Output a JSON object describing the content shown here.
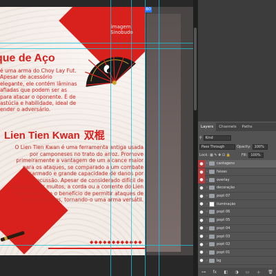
{
  "document": {
    "title1": "que de Aço",
    "para1": "é uma arma do Choy Lay Fut. Apesar de acessório elegante, ele contém lâminas afiadas que podem ser as para atacar o oponente. É de astúcia e habilidade, ideal de ender o adversário.",
    "title2": "Lien Tien Kwan",
    "title2_cn": "双棍",
    "para2": "O Lien Tien Kwan é uma ferramenta antiga usada por camponeses no trato do arroz. Promove primeiramente a vantagem de um alcance maior para os ataques, se comparado a um combate desarmado e grande capacidade de danos por concussão. Apesar de considerado difícil de controlar por muitos, a corda ou a corrente do Lien Tien Kwan tem o benefício de permitir ataques de vários ângulos, tornando-o uma arma versátil.",
    "image_caption": "imagem:\nSinobudo",
    "accent_color": "#d8201c"
  },
  "panel": {
    "tabs": [
      "Layers",
      "Channels",
      "Paths"
    ],
    "kind_label": "Kind",
    "blend_mode": "Pass Through",
    "opacity_label": "Opacity:",
    "opacity_value": "100%",
    "lock_label": "Lock:",
    "fill_label": "Fill:",
    "fill_value": "100%"
  },
  "layers": [
    {
      "name": "cantagens",
      "eye": true,
      "red": true,
      "type": "folder",
      "selected": true
    },
    {
      "name": "faixas",
      "eye": true,
      "red": true,
      "type": "folder"
    },
    {
      "name": "overlay",
      "eye": true,
      "red": true,
      "type": "folder"
    },
    {
      "name": "decoração",
      "eye": true,
      "red": false,
      "type": "folder"
    },
    {
      "name": "popt 07",
      "eye": true,
      "red": false,
      "type": "folder"
    },
    {
      "name": "iluminação",
      "eye": true,
      "red": false,
      "type": "thumb"
    },
    {
      "name": "popt 06",
      "eye": true,
      "red": false,
      "type": "folder"
    },
    {
      "name": "popt 05",
      "eye": true,
      "red": false,
      "type": "folder"
    },
    {
      "name": "popt 04",
      "eye": true,
      "red": false,
      "type": "folder"
    },
    {
      "name": "popt 03",
      "eye": true,
      "red": false,
      "type": "folder"
    },
    {
      "name": "popt 02",
      "eye": true,
      "red": false,
      "type": "folder"
    },
    {
      "name": "popt 01",
      "eye": true,
      "red": false,
      "type": "folder"
    },
    {
      "name": "bg",
      "eye": true,
      "red": false,
      "type": "folder"
    }
  ],
  "guide_badge": "80"
}
